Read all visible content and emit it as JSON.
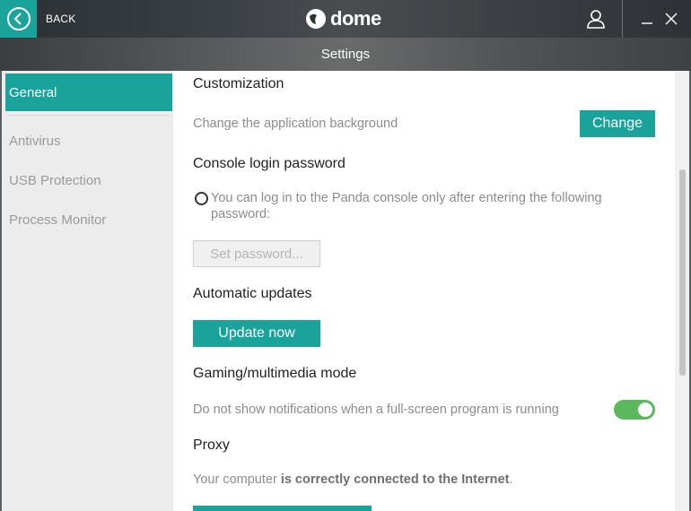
{
  "titlebar": {
    "back_label": "BACK",
    "brand": "dome"
  },
  "header": {
    "title": "Settings"
  },
  "sidebar": {
    "items": [
      {
        "label": "General",
        "active": true
      },
      {
        "label": "Antivirus",
        "active": false
      },
      {
        "label": "USB Protection",
        "active": false
      },
      {
        "label": "Process Monitor",
        "active": false
      }
    ]
  },
  "customization": {
    "title": "Customization",
    "desc": "Change the application background",
    "button": "Change"
  },
  "console_password": {
    "title": "Console login password",
    "radio_text": "You can log in to the Panda console only after entering the following password:",
    "button": "Set password..."
  },
  "updates": {
    "title": "Automatic updates",
    "button": "Update now"
  },
  "gaming": {
    "title": "Gaming/multimedia mode",
    "desc": "Do not show notifications when a full-screen program is running",
    "toggle_on": true
  },
  "proxy": {
    "title": "Proxy",
    "desc_prefix": "Your computer ",
    "desc_bold": "is correctly connected to the Internet",
    "desc_suffix": "."
  },
  "colors": {
    "accent": "#1aa39b",
    "toggle": "#5cb85c"
  },
  "icons": [
    "back-arrow-icon",
    "panda-logo-icon",
    "user-icon",
    "minimize-icon",
    "close-icon"
  ]
}
